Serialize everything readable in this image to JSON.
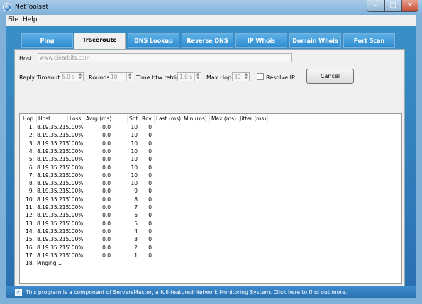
{
  "window": {
    "title": "NetToolset",
    "icons": {
      "app": "globe-icon",
      "minimize": "minimize-icon",
      "maximize": "maximize-icon",
      "close": "close-icon"
    },
    "minimize_glyph": "–",
    "maximize_glyph": "□",
    "close_glyph": "✕"
  },
  "menu": [
    "File",
    "Help"
  ],
  "tabs": [
    {
      "label": "Ping",
      "active": false
    },
    {
      "label": "Traceroute",
      "active": true
    },
    {
      "label": "DNS Lookup",
      "active": false
    },
    {
      "label": "Reverse DNS",
      "active": false
    },
    {
      "label": "IP Whois",
      "active": false
    },
    {
      "label": "Domain Whois",
      "active": false
    },
    {
      "label": "Port Scan",
      "active": false
    }
  ],
  "form": {
    "host_label": "Host:",
    "host_placeholder": "www.clearbits.com",
    "reply_timeout_label": "Reply Timeout:",
    "reply_timeout_value": "5.0 s",
    "rounds_label": "Rounds:",
    "rounds_value": "10",
    "retries_label": "Time btw retries:",
    "retries_value": "1.0 s",
    "max_hops_label": "Max Hops",
    "max_hops_value": "30",
    "resolve_ip_label": "Resolve IP",
    "resolve_ip_checked": false,
    "cancel_label": "Cancel"
  },
  "results": {
    "columns": [
      "Hop",
      "Host",
      "Loss",
      "Avrg (ms)",
      "Snt",
      "Rcv",
      "Last (ms)",
      "Min (ms)",
      "Max (ms)",
      "Jitter (ms)"
    ],
    "rows": [
      {
        "hop": "1.",
        "host": "8.19.35.215",
        "loss": "100%",
        "avg": "0.0",
        "snt": "10",
        "rcv": "0"
      },
      {
        "hop": "2.",
        "host": "8.19.35.215",
        "loss": "100%",
        "avg": "0.0",
        "snt": "10",
        "rcv": "0"
      },
      {
        "hop": "3.",
        "host": "8.19.35.215",
        "loss": "100%",
        "avg": "0.0",
        "snt": "10",
        "rcv": "0"
      },
      {
        "hop": "4.",
        "host": "8.19.35.215",
        "loss": "100%",
        "avg": "0.0",
        "snt": "10",
        "rcv": "0"
      },
      {
        "hop": "5.",
        "host": "8.19.35.215",
        "loss": "100%",
        "avg": "0.0",
        "snt": "10",
        "rcv": "0"
      },
      {
        "hop": "6.",
        "host": "8.19.35.215",
        "loss": "100%",
        "avg": "0.0",
        "snt": "10",
        "rcv": "0"
      },
      {
        "hop": "7.",
        "host": "8.19.35.215",
        "loss": "100%",
        "avg": "0.0",
        "snt": "10",
        "rcv": "0"
      },
      {
        "hop": "8.",
        "host": "8.19.35.215",
        "loss": "100%",
        "avg": "0.0",
        "snt": "10",
        "rcv": "0"
      },
      {
        "hop": "9.",
        "host": "8.19.35.215",
        "loss": "100%",
        "avg": "0.0",
        "snt": "9",
        "rcv": "0"
      },
      {
        "hop": "10.",
        "host": "8.19.35.215",
        "loss": "100%",
        "avg": "0.0",
        "snt": "8",
        "rcv": "0"
      },
      {
        "hop": "11.",
        "host": "8.19.35.215",
        "loss": "100%",
        "avg": "0.0",
        "snt": "7",
        "rcv": "0"
      },
      {
        "hop": "12.",
        "host": "8.19.35.215",
        "loss": "100%",
        "avg": "0.0",
        "snt": "6",
        "rcv": "0"
      },
      {
        "hop": "13.",
        "host": "8.19.35.215",
        "loss": "100%",
        "avg": "0.0",
        "snt": "5",
        "rcv": "0"
      },
      {
        "hop": "14.",
        "host": "8.19.35.215",
        "loss": "100%",
        "avg": "0.0",
        "snt": "4",
        "rcv": "0"
      },
      {
        "hop": "15.",
        "host": "8.19.35.215",
        "loss": "100%",
        "avg": "0.0",
        "snt": "3",
        "rcv": "0"
      },
      {
        "hop": "16.",
        "host": "8.19.35.215",
        "loss": "100%",
        "avg": "0.0",
        "snt": "2",
        "rcv": "0"
      },
      {
        "hop": "17.",
        "host": "8.19.35.215",
        "loss": "100%",
        "avg": "0.0",
        "snt": "1",
        "rcv": "0"
      },
      {
        "hop": "18.",
        "host": "Pinging...",
        "loss": "",
        "avg": "",
        "snt": "",
        "rcv": ""
      }
    ]
  },
  "status": {
    "checked": true,
    "check_glyph": "✓",
    "text": "This program is a component of ServersMaster, a full-featured Network Monitoring System. Click here to find out more."
  }
}
